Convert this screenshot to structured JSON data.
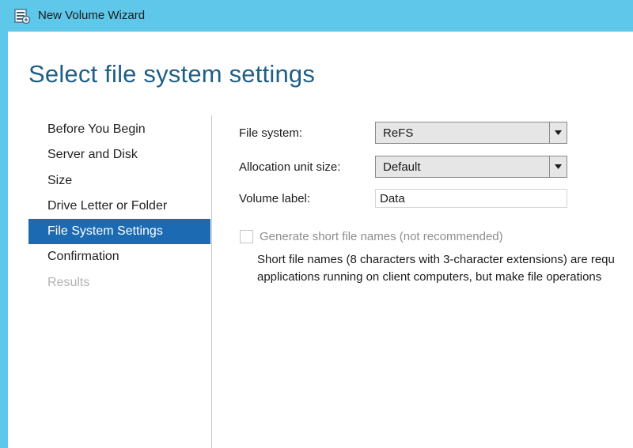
{
  "window": {
    "title": "New Volume Wizard",
    "icon": "volume-wizard-icon"
  },
  "page": {
    "heading": "Select file system settings"
  },
  "nav": {
    "items": [
      {
        "label": "Before You Begin",
        "state": "normal"
      },
      {
        "label": "Server and Disk",
        "state": "normal"
      },
      {
        "label": "Size",
        "state": "normal"
      },
      {
        "label": "Drive Letter or Folder",
        "state": "normal"
      },
      {
        "label": "File System Settings",
        "state": "active"
      },
      {
        "label": "Confirmation",
        "state": "normal"
      },
      {
        "label": "Results",
        "state": "disabled"
      }
    ]
  },
  "form": {
    "file_system": {
      "label": "File system:",
      "value": "ReFS"
    },
    "allocation_unit_size": {
      "label": "Allocation unit size:",
      "value": "Default"
    },
    "volume_label": {
      "label": "Volume label:",
      "value": "Data"
    },
    "short_names": {
      "label": "Generate short file names (not recommended)",
      "checked": false,
      "enabled": false
    },
    "description": {
      "line1": "Short file names (8 characters with 3-character extensions) are requ",
      "line2": "applications running on client computers, but make file operations"
    }
  },
  "colors": {
    "titlebar": "#5ec7ea",
    "heading": "#1e5f87",
    "nav_active_bg": "#1c6bb2"
  }
}
